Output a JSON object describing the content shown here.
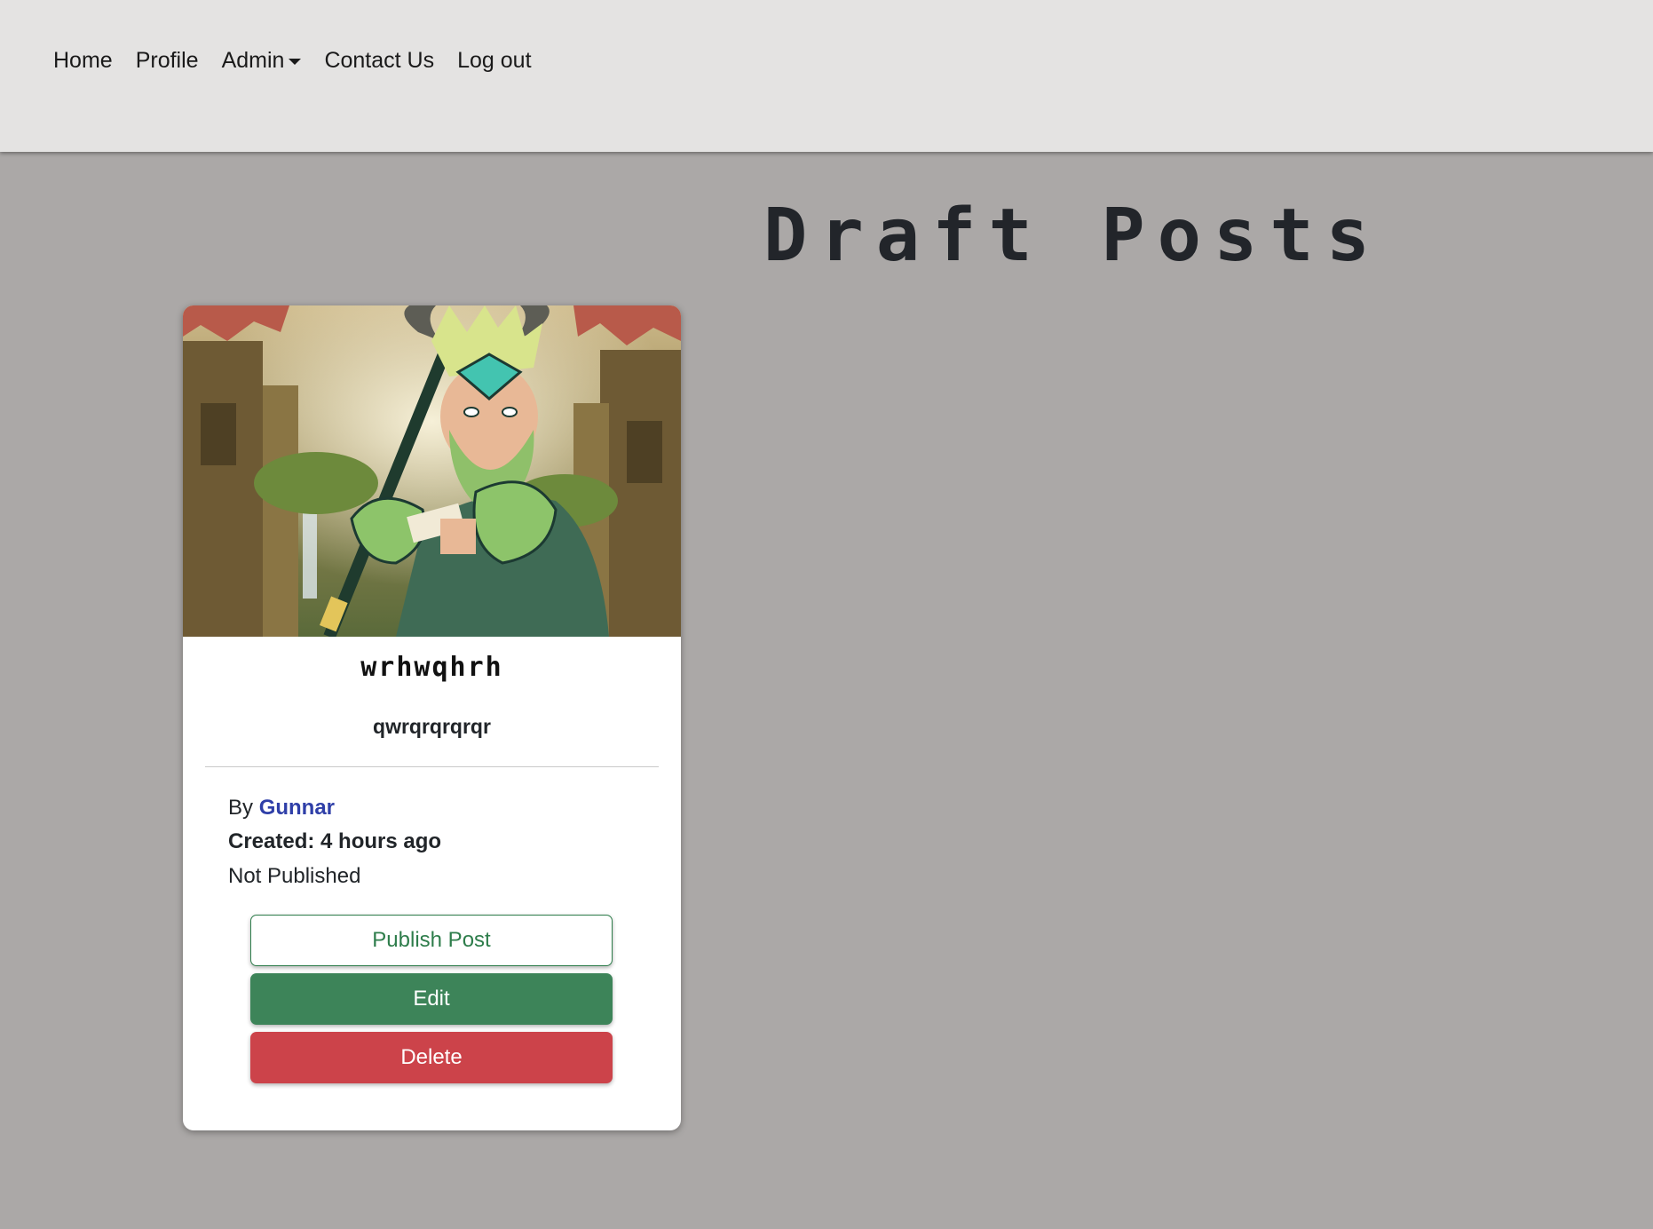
{
  "nav": {
    "items": [
      {
        "label": "Home"
      },
      {
        "label": "Profile"
      },
      {
        "label": "Admin"
      },
      {
        "label": "Contact Us"
      },
      {
        "label": "Log out"
      }
    ]
  },
  "page": {
    "title": "Draft Posts"
  },
  "post": {
    "title": "wrhwqhrh",
    "subtitle": "qwrqrqrqrqr",
    "by_prefix": "By",
    "author": "Gunnar",
    "created": "Created: 4 hours ago",
    "status": "Not Published",
    "image_alt": "Post cover image"
  },
  "actions": {
    "publish_label": "Publish Post",
    "edit_label": "Edit",
    "delete_label": "Delete"
  },
  "colors": {
    "page_background": "#aba8a7",
    "navbar_background": "#e4e3e2",
    "author_link": "#2f3fa8",
    "publish_outline": "#2e7d4b",
    "edit_button": "#3d8459",
    "delete_button": "#cc434a"
  }
}
